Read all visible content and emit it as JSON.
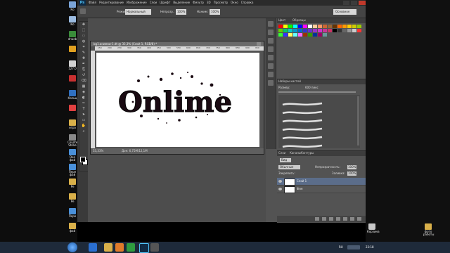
{
  "desktop": {
    "left_icons": [
      {
        "label": "Ко",
        "color": "#7aa4d8"
      },
      {
        "label": "Ко",
        "color": "#9bbbe0"
      },
      {
        "label": "drweb",
        "color": "#3a8c3a"
      },
      {
        "label": "",
        "color": "#e0a020"
      },
      {
        "label": "127.0",
        "color": "#d0d0d0"
      },
      {
        "label": "",
        "color": "#c83030"
      },
      {
        "label": "Кольц",
        "color": "#3070c0"
      },
      {
        "label": "",
        "color": "#e04040"
      },
      {
        "label": "игра",
        "color": "#d9b04a"
      },
      {
        "label": "Counte Strike",
        "color": "#888888"
      },
      {
        "label": "Оке фай",
        "color": "#4a90d9"
      },
      {
        "label": "Пере фай",
        "color": "#4a90d9"
      },
      {
        "label": "Ре",
        "color": "#d9b04a"
      },
      {
        "label": "Ре",
        "color": "#d9b04a"
      },
      {
        "label": "Пере",
        "color": "#4a90d9"
      },
      {
        "label": "фай",
        "color": "#d9b04a"
      }
    ],
    "right_icons": [
      {
        "label": "фото работы",
        "color": "#d9b04a"
      }
    ],
    "trash_label": "Корзина"
  },
  "menubar": {
    "logo": "Ps",
    "items": [
      "Файл",
      "Редактирование",
      "Изображение",
      "Слои",
      "Шрифт",
      "Выделение",
      "Фильтр",
      "3D",
      "Просмотр",
      "Окно",
      "Справка"
    ]
  },
  "options_bar": {
    "mode_label": "Режим:",
    "mode_value": "Нормальный",
    "opacity_label": "Непрозр.:",
    "opacity_value": "100%",
    "flow_label": "Нажим:",
    "flow_value": "100%",
    "workspace_value": "Основное"
  },
  "document": {
    "tab_title": "bg1.анимки-1.dt @ 33,3% (Слой 1, RGB/8) *",
    "ruler_marks": [
      "150",
      "200",
      "250",
      "300",
      "350",
      "400",
      "450",
      "500",
      "550",
      "600",
      "650",
      "700",
      "750",
      "800",
      "850",
      "900",
      "950"
    ],
    "canvas_text": "Onlime",
    "zoom": "33,33%",
    "doc_info": "Док: 6,75М/12,1М"
  },
  "panels": {
    "swatches_tabs": [
      "Цвет",
      "Образцы"
    ],
    "swatch_colors": [
      "#ff0000",
      "#ffff00",
      "#00ff00",
      "#00ffff",
      "#0000ff",
      "#ff00ff",
      "#ffffff",
      "#ffcc99",
      "#ff9966",
      "#cc6633",
      "#996633",
      "#663300",
      "#ff6600",
      "#ff9900",
      "#ffcc00",
      "#cccc00",
      "#99cc00",
      "#66cc00",
      "#00cc66",
      "#00cccc",
      "#0099cc",
      "#0066cc",
      "#3333cc",
      "#6633cc",
      "#9933cc",
      "#cc33cc",
      "#cc3399",
      "#cc3366",
      "#000000",
      "#333333",
      "#666666",
      "#999999",
      "#cccccc",
      "#ff3333",
      "#33ff33",
      "#3333ff",
      "#ffff66",
      "#66ffff",
      "#ff66ff",
      "#993300",
      "#339900",
      "#003399",
      "#990066",
      "#669999"
    ],
    "brush_panel_title": "Наборы кистей",
    "brush_size_label": "Размер:",
    "brush_size_value": "600 пикс",
    "layers_tabs": [
      "Слои",
      "Каналы",
      "Контуры"
    ],
    "layers_kind": "Вид",
    "blend_mode": "Обычные",
    "opacity_label": "Непрозрачность:",
    "opacity_value": "100%",
    "lock_label": "Закрепить:",
    "fill_label": "Заливка:",
    "fill_value": "100%",
    "layers": [
      {
        "name": "Слой 1",
        "selected": true
      },
      {
        "name": "Фон",
        "selected": false
      }
    ]
  },
  "taskbar": {
    "lang": "RU",
    "time": "23:18"
  }
}
